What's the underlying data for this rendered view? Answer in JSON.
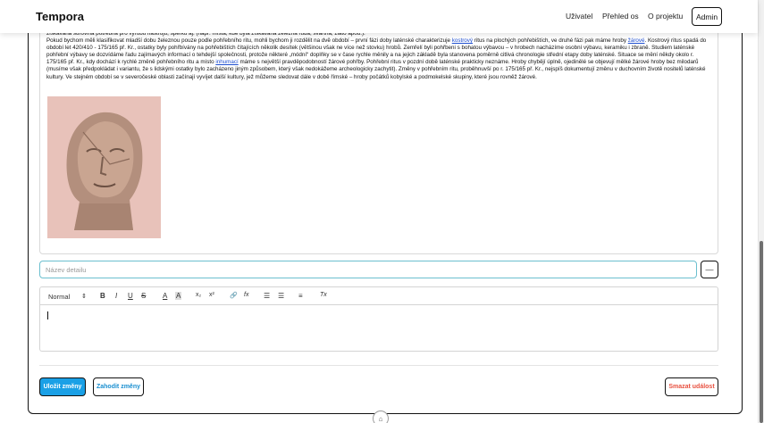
{
  "navbar": {
    "brand": "Tempora",
    "links": [
      "Uživatel",
      "Přehled os",
      "O projektu"
    ],
    "admin_label": "Admin"
  },
  "article": {
    "line1": "získávána surovina potřebná pro výrobu nástrojů, šperků aj. (např. místa, kde byla získávána železná ruda, švartna, zlato apod.).",
    "p2_a": "Pokud bychom měli klasifikovat mladší dobu železnou pouze podle pohřebního ritu, mohli bychom ji rozdělit na dvě období – první fázi doby laténské charakterizuje ",
    "link_kostrovy": "kostrový",
    "p2_b": " ritus na plochých pohřebištích, ve druhé fázi pak máme hroby ",
    "link_zarove": "žárové",
    "p2_c": ". Kostrový ritus spadá do období let 420/410 - 175/165 př. Kr., ostatky byly pohřbívány na pohřebištích čítajících několik desítek (většinou však ne více než stovku) hrobů. Zemřelí byli pohřbeni s bohatou výbavou – v hrobech nacházíme osobní výbavu, keramiku i zbraně. Studiem laténské pohřební výbavy se dozvídáme řadu zajímavých informací o tehdejší společnosti, protože některé „módní“ doplňky se v čase rychle měnily a na jejich základě byla stanovena poměrně citlivá chronologie střední etapy doby laténské. Situace se mění někdy okolo r. 175/165 př. Kr., kdy dochází k rychlé změně pohřebního ritu a místo ",
    "link_inhumaci": "inhumací",
    "p2_d": " máme s největší pravděpodobností žárové pohřby. Pohřební ritus v pozdní době laténské prakticky neznáme. Hroby chybějí úplně, ojedinělé se objevují mělké žárové hroby bez milodarů (musíme však předpokládat i variantu, že s lidskými ostatky bylo zacházeno jiným způsobem, který však nedokážeme archeologicky zachytit). Změny v pohřebním ritu, proběhnuvší po r. 175/165 př. Kr., nejspíš dokumentují změnu v duchovním životě nositelů laténské kultury. Ve stejném období se v severočeské oblasti začínají vyvíjet další kultury, jež můžeme sledovat dále v době římské – hroby počátků kobylské a podmokelské skupiny, které jsou rovněž žárové."
  },
  "detail": {
    "placeholder": "Název detailu",
    "dash_label": "—"
  },
  "editor": {
    "format_select": "Normal",
    "select_arrow": "⇕",
    "bold": "B",
    "italic": "I",
    "underline": "U",
    "strike": "S",
    "color": "A",
    "background": "A",
    "subscript": "x₂",
    "superscript": "x²",
    "link": "🔗",
    "formula": "fx",
    "ordered_list": "☰",
    "bullet_list": "☰",
    "align": "≡",
    "clear": "Tx"
  },
  "buttons": {
    "save": "Uložit změny",
    "discard": "Zahodit změny",
    "delete": "Smazat událost"
  },
  "colors": {
    "primary": "#1aa0e6",
    "danger": "#e8503f",
    "link": "#1f4fd0",
    "input_focus": "#6bbfcf"
  }
}
